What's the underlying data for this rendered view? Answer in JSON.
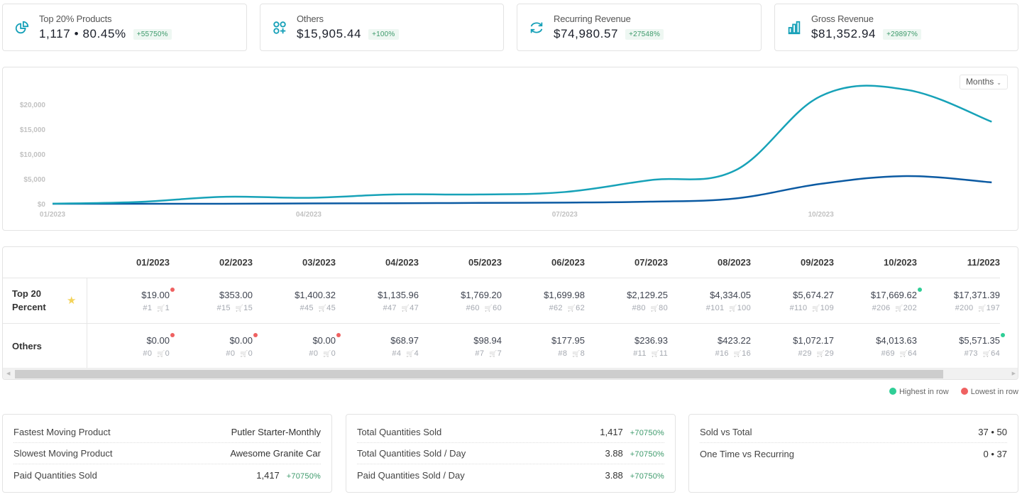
{
  "kpis": [
    {
      "title": "Top 20% Products",
      "value": "1,117 • 80.45%",
      "change": "+55750%",
      "icon": "pie-chart-icon"
    },
    {
      "title": "Others",
      "value": "$15,905.44",
      "change": "+100%",
      "icon": "apps-add-icon"
    },
    {
      "title": "Recurring Revenue",
      "value": "$74,980.57",
      "change": "+27548%",
      "icon": "refresh-icon"
    },
    {
      "title": "Gross Revenue",
      "value": "$81,352.94",
      "change": "+29897%",
      "icon": "bar-chart-icon"
    }
  ],
  "chart": {
    "period_select": "Months"
  },
  "chart_data": {
    "type": "line",
    "title": "",
    "xlabel": "",
    "ylabel": "",
    "x": [
      "01/2023",
      "02/2023",
      "03/2023",
      "04/2023",
      "05/2023",
      "06/2023",
      "07/2023",
      "08/2023",
      "09/2023",
      "10/2023",
      "11/2023",
      "12/2023"
    ],
    "x_tick_labels": [
      "01/2023",
      "04/2023",
      "07/2023",
      "10/2023"
    ],
    "y_tick_labels": [
      "$0",
      "$5,000",
      "$10,000",
      "$15,000",
      "$20,000"
    ],
    "y_ticks": [
      0,
      5000,
      10000,
      15000,
      20000
    ],
    "ylim": [
      0,
      20000
    ],
    "grid": false,
    "series": [
      {
        "name": "Gross",
        "color": "#17a2b8",
        "values": [
          19,
          353,
          1400,
          1205,
          1868,
          1878,
          2366,
          4757,
          6746,
          21683,
          22943,
          16500
        ]
      },
      {
        "name": "Others",
        "color": "#0b5aa2",
        "values": [
          0,
          0,
          0,
          69,
          99,
          178,
          237,
          423,
          1072,
          4014,
          5571,
          4300
        ]
      }
    ]
  },
  "table": {
    "columns": [
      "01/2023",
      "02/2023",
      "03/2023",
      "04/2023",
      "05/2023",
      "06/2023",
      "07/2023",
      "08/2023",
      "09/2023",
      "10/2023",
      "11/2023"
    ],
    "rows": [
      {
        "label": "Top 20 Percent",
        "starred": true,
        "cells": [
          {
            "amount": "$19.00",
            "count": "#1",
            "orders": "1",
            "mark": "low"
          },
          {
            "amount": "$353.00",
            "count": "#15",
            "orders": "15",
            "mark": ""
          },
          {
            "amount": "$1,400.32",
            "count": "#45",
            "orders": "45",
            "mark": ""
          },
          {
            "amount": "$1,135.96",
            "count": "#47",
            "orders": "47",
            "mark": ""
          },
          {
            "amount": "$1,769.20",
            "count": "#60",
            "orders": "60",
            "mark": ""
          },
          {
            "amount": "$1,699.98",
            "count": "#62",
            "orders": "62",
            "mark": ""
          },
          {
            "amount": "$2,129.25",
            "count": "#80",
            "orders": "80",
            "mark": ""
          },
          {
            "amount": "$4,334.05",
            "count": "#101",
            "orders": "100",
            "mark": ""
          },
          {
            "amount": "$5,674.27",
            "count": "#110",
            "orders": "109",
            "mark": ""
          },
          {
            "amount": "$17,669.62",
            "count": "#206",
            "orders": "202",
            "mark": "high"
          },
          {
            "amount": "$17,371.39",
            "count": "#200",
            "orders": "197",
            "mark": ""
          }
        ]
      },
      {
        "label": "Others",
        "starred": false,
        "cells": [
          {
            "amount": "$0.00",
            "count": "#0",
            "orders": "0",
            "mark": "low"
          },
          {
            "amount": "$0.00",
            "count": "#0",
            "orders": "0",
            "mark": "low"
          },
          {
            "amount": "$0.00",
            "count": "#0",
            "orders": "0",
            "mark": "low"
          },
          {
            "amount": "$68.97",
            "count": "#4",
            "orders": "4",
            "mark": ""
          },
          {
            "amount": "$98.94",
            "count": "#7",
            "orders": "7",
            "mark": ""
          },
          {
            "amount": "$177.95",
            "count": "#8",
            "orders": "8",
            "mark": ""
          },
          {
            "amount": "$236.93",
            "count": "#11",
            "orders": "11",
            "mark": ""
          },
          {
            "amount": "$423.22",
            "count": "#16",
            "orders": "16",
            "mark": ""
          },
          {
            "amount": "$1,072.17",
            "count": "#29",
            "orders": "29",
            "mark": ""
          },
          {
            "amount": "$4,013.63",
            "count": "#69",
            "orders": "64",
            "mark": ""
          },
          {
            "amount": "$5,571.35",
            "count": "#73",
            "orders": "64",
            "mark": "high"
          }
        ]
      }
    ],
    "legend": {
      "highest": "Highest in row",
      "lowest": "Lowest in row"
    },
    "colors": {
      "highest": "#2fce96",
      "lowest": "#ef6161"
    }
  },
  "stats": [
    {
      "rows": [
        {
          "label": "Fastest Moving Product",
          "value": "Putler Starter-Monthly",
          "change": ""
        },
        {
          "label": "Slowest Moving Product",
          "value": "Awesome Granite Car",
          "change": ""
        },
        {
          "label": "Paid Quantities Sold",
          "value": "1,417",
          "change": "+70750%"
        }
      ]
    },
    {
      "rows": [
        {
          "label": "Total Quantities Sold",
          "value": "1,417",
          "change": "+70750%"
        },
        {
          "label": "Total Quantities Sold / Day",
          "value": "3.88",
          "change": "+70750%"
        },
        {
          "label": "Paid Quantities Sold / Day",
          "value": "3.88",
          "change": "+70750%"
        }
      ]
    },
    {
      "rows": [
        {
          "label": "Sold vs Total",
          "value": "37 • 50",
          "change": ""
        },
        {
          "label": "One Time vs Recurring",
          "value": "0 • 37",
          "change": ""
        }
      ]
    }
  ]
}
